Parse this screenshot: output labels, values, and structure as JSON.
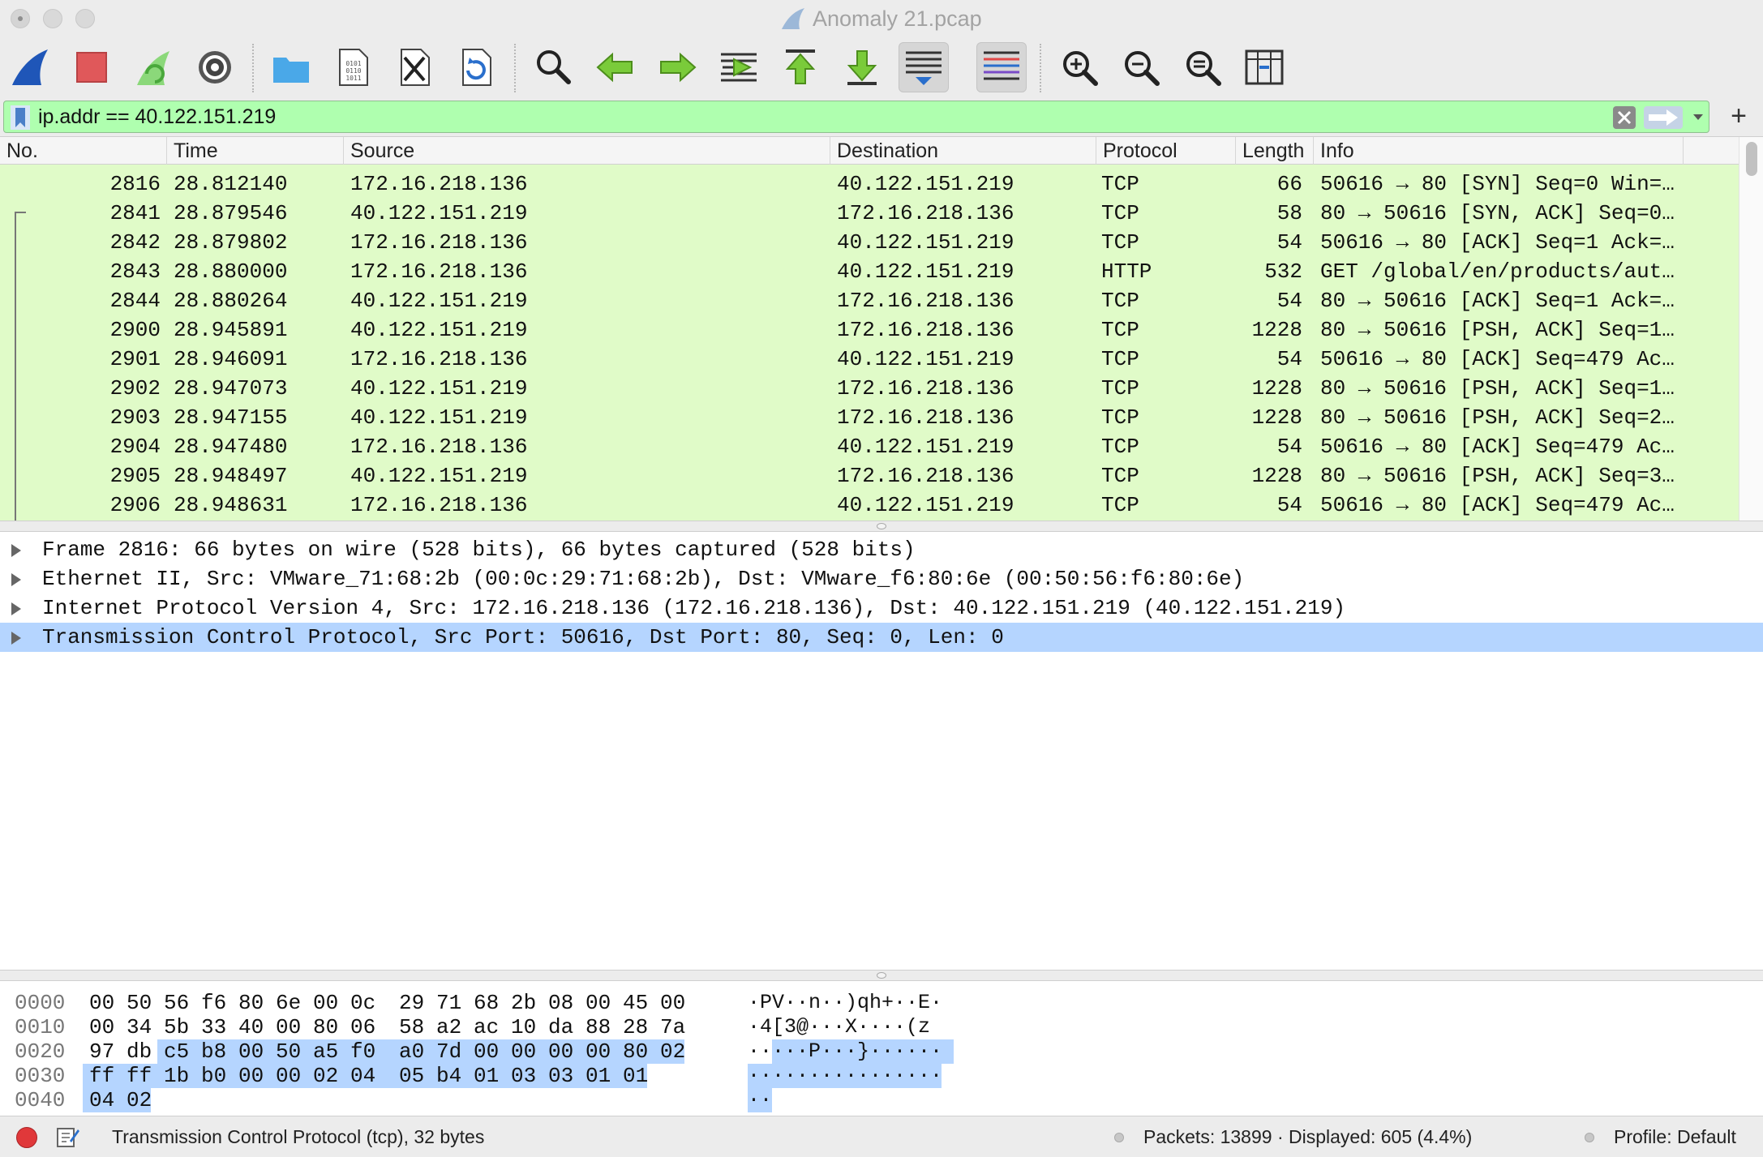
{
  "window": {
    "title": "Anomaly 21.pcap"
  },
  "toolbar": {
    "buttons": [
      "start-capture",
      "stop-capture",
      "restart-capture",
      "capture-options",
      "open-file",
      "save-file",
      "close-file",
      "reload-file",
      "find-packet",
      "go-back",
      "go-forward",
      "go-to-packet",
      "go-first-packet",
      "go-last-packet",
      "auto-scroll",
      "colorize",
      "zoom-in",
      "zoom-out",
      "normal-size",
      "resize-columns"
    ]
  },
  "filter": {
    "value": "ip.addr == 40.122.151.219",
    "add_label": "+"
  },
  "packet_list": {
    "columns": [
      "No.",
      "Time",
      "Source",
      "Destination",
      "Protocol",
      "Length",
      "Info"
    ],
    "rows": [
      {
        "no": "2816",
        "time": "28.812140",
        "src": "172.16.218.136",
        "dst": "40.122.151.219",
        "proto": "TCP",
        "len": "66",
        "info": "50616 → 80 [SYN] Seq=0 Win=…"
      },
      {
        "no": "2841",
        "time": "28.879546",
        "src": "40.122.151.219",
        "dst": "172.16.218.136",
        "proto": "TCP",
        "len": "58",
        "info": "80 → 50616 [SYN, ACK] Seq=0…"
      },
      {
        "no": "2842",
        "time": "28.879802",
        "src": "172.16.218.136",
        "dst": "40.122.151.219",
        "proto": "TCP",
        "len": "54",
        "info": "50616 → 80 [ACK] Seq=1 Ack=…"
      },
      {
        "no": "2843",
        "time": "28.880000",
        "src": "172.16.218.136",
        "dst": "40.122.151.219",
        "proto": "HTTP",
        "len": "532",
        "info": "GET /global/en/products/aut…"
      },
      {
        "no": "2844",
        "time": "28.880264",
        "src": "40.122.151.219",
        "dst": "172.16.218.136",
        "proto": "TCP",
        "len": "54",
        "info": "80 → 50616 [ACK] Seq=1 Ack=…"
      },
      {
        "no": "2900",
        "time": "28.945891",
        "src": "40.122.151.219",
        "dst": "172.16.218.136",
        "proto": "TCP",
        "len": "1228",
        "info": "80 → 50616 [PSH, ACK] Seq=1…"
      },
      {
        "no": "2901",
        "time": "28.946091",
        "src": "172.16.218.136",
        "dst": "40.122.151.219",
        "proto": "TCP",
        "len": "54",
        "info": "50616 → 80 [ACK] Seq=479 Ac…"
      },
      {
        "no": "2902",
        "time": "28.947073",
        "src": "40.122.151.219",
        "dst": "172.16.218.136",
        "proto": "TCP",
        "len": "1228",
        "info": "80 → 50616 [PSH, ACK] Seq=1…"
      },
      {
        "no": "2903",
        "time": "28.947155",
        "src": "40.122.151.219",
        "dst": "172.16.218.136",
        "proto": "TCP",
        "len": "1228",
        "info": "80 → 50616 [PSH, ACK] Seq=2…"
      },
      {
        "no": "2904",
        "time": "28.947480",
        "src": "172.16.218.136",
        "dst": "40.122.151.219",
        "proto": "TCP",
        "len": "54",
        "info": "50616 → 80 [ACK] Seq=479 Ac…"
      },
      {
        "no": "2905",
        "time": "28.948497",
        "src": "40.122.151.219",
        "dst": "172.16.218.136",
        "proto": "TCP",
        "len": "1228",
        "info": "80 → 50616 [PSH, ACK] Seq=3…"
      },
      {
        "no": "2906",
        "time": "28.948631",
        "src": "172.16.218.136",
        "dst": "40.122.151.219",
        "proto": "TCP",
        "len": "54",
        "info": "50616 → 80 [ACK] Seq=479 Ac…"
      }
    ],
    "row_color": "#e0fbc8"
  },
  "details": {
    "items": [
      {
        "text": "Frame 2816: 66 bytes on wire (528 bits), 66 bytes captured (528 bits)",
        "selected": false
      },
      {
        "text": "Ethernet II, Src: VMware_71:68:2b (00:0c:29:71:68:2b), Dst: VMware_f6:80:6e (00:50:56:f6:80:6e)",
        "selected": false
      },
      {
        "text": "Internet Protocol Version 4, Src: 172.16.218.136 (172.16.218.136), Dst: 40.122.151.219 (40.122.151.219)",
        "selected": false
      },
      {
        "text": "Transmission Control Protocol, Src Port: 50616, Dst Port: 80, Seq: 0, Len: 0",
        "selected": true
      }
    ],
    "selection_color": "#b5d5ff"
  },
  "hex": {
    "lines": [
      {
        "offset": "0000",
        "bytes": [
          "00",
          "50",
          "56",
          "f6",
          "80",
          "6e",
          "00",
          "0c",
          "29",
          "71",
          "68",
          "2b",
          "08",
          "00",
          "45",
          "00"
        ],
        "ascii": "·PV··n··)qh+··E·"
      },
      {
        "offset": "0010",
        "bytes": [
          "00",
          "34",
          "5b",
          "33",
          "40",
          "00",
          "80",
          "06",
          "58",
          "a2",
          "ac",
          "10",
          "da",
          "88",
          "28",
          "7a"
        ],
        "ascii": "·4[3@···X····(z"
      },
      {
        "offset": "0020",
        "bytes": [
          "97",
          "db",
          "c5",
          "b8",
          "00",
          "50",
          "a5",
          "f0",
          "a0",
          "7d",
          "00",
          "00",
          "00",
          "00",
          "80",
          "02"
        ],
        "ascii": "·····P···}······"
      },
      {
        "offset": "0030",
        "bytes": [
          "ff",
          "ff",
          "1b",
          "b0",
          "00",
          "00",
          "02",
          "04",
          "05",
          "b4",
          "01",
          "03",
          "03",
          "01",
          "01"
        ],
        "ascii": "················"
      },
      {
        "offset": "0040",
        "bytes": [
          "04",
          "02"
        ],
        "ascii": "··"
      }
    ]
  },
  "status": {
    "text": "Transmission Control Protocol (tcp), 32 bytes",
    "packets": "Packets: 13899 · Displayed: 605 (4.4%)",
    "profile": "Profile: Default"
  }
}
